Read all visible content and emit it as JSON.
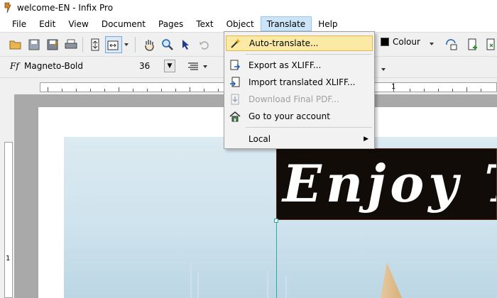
{
  "window": {
    "title": "welcome-EN - Infix Pro"
  },
  "menubar": {
    "items": [
      "File",
      "Edit",
      "View",
      "Document",
      "Pages",
      "Text",
      "Object",
      "Translate",
      "Help"
    ],
    "active": "Translate"
  },
  "toolbar": {
    "colour_label": "Colour",
    "icons": [
      "open-folder-icon",
      "save-icon",
      "save-as-icon",
      "print-icon",
      "fit-page-icon",
      "fit-width-icon",
      "hand-tool-icon",
      "zoom-icon",
      "select-arrow-icon",
      "undo-icon"
    ]
  },
  "font_bar": {
    "font_prefix": "Ff",
    "font_name": "Magneto-Bold",
    "font_size": "36"
  },
  "ruler": {
    "top_label": "1",
    "left_label": "1"
  },
  "translate_menu": {
    "items": [
      {
        "label": "Auto-translate...",
        "icon": "magic-wand-icon",
        "state": "highlighted"
      },
      {
        "label": "Export as XLIFF...",
        "icon": "export-xliff-icon",
        "state": "enabled"
      },
      {
        "label": "Import translated XLIFF...",
        "icon": "import-xliff-icon",
        "state": "enabled"
      },
      {
        "label": "Download Final PDF...",
        "icon": "download-pdf-icon",
        "state": "disabled"
      },
      {
        "label": "Go to your account",
        "icon": "home-icon",
        "state": "enabled"
      },
      {
        "label": "Local",
        "icon": "",
        "state": "submenu"
      }
    ]
  },
  "canvas": {
    "banner_text": "Enjoy T"
  },
  "colors": {
    "accent_highlight": "#fbe9a6",
    "menu_active": "#cce4f7",
    "banner_bg": "#120c08",
    "guide": "#2aa9a5"
  }
}
